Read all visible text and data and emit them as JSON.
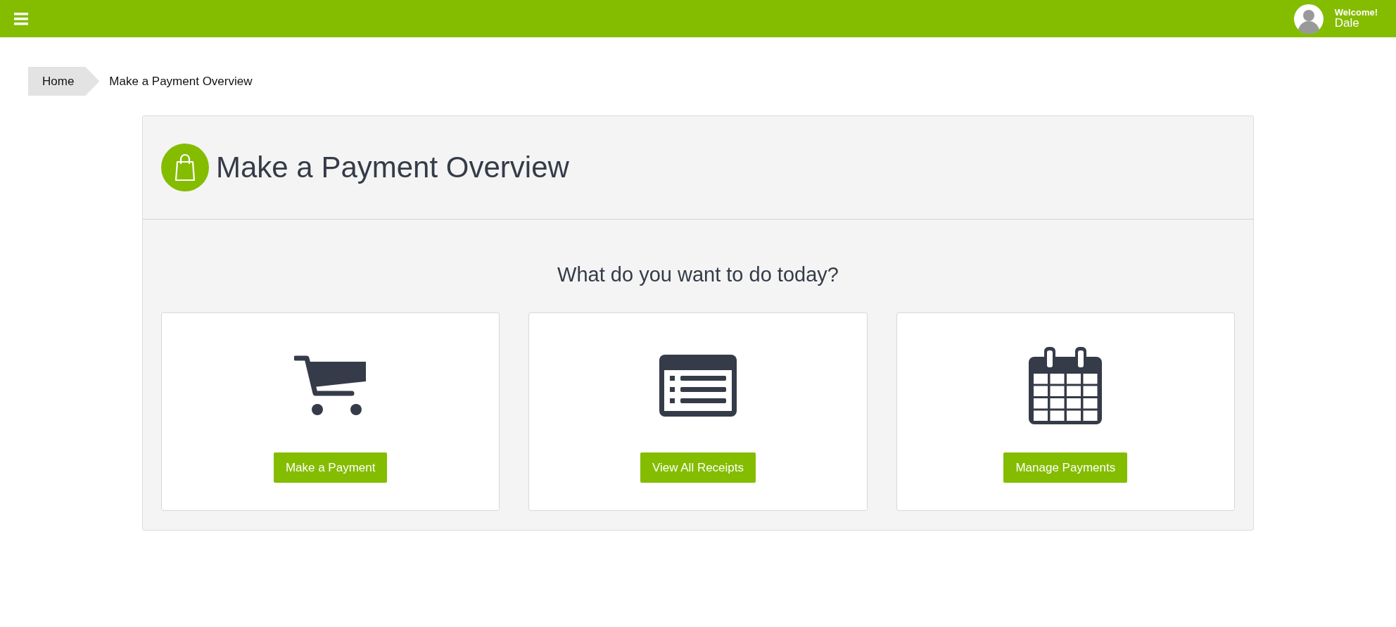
{
  "header": {
    "welcome": "Welcome!",
    "user": "Dale"
  },
  "breadcrumb": [
    {
      "label": "Home",
      "kind": "link"
    },
    {
      "label": "Make a Payment Overview",
      "kind": "current"
    }
  ],
  "panel": {
    "title": "Make a Payment Overview",
    "prompt": "What do you want to do today?"
  },
  "cards": [
    {
      "kind": "cart",
      "button": "Make a Payment"
    },
    {
      "kind": "list",
      "button": "View All Receipts"
    },
    {
      "kind": "calendar",
      "button": "Manage Payments"
    }
  ]
}
